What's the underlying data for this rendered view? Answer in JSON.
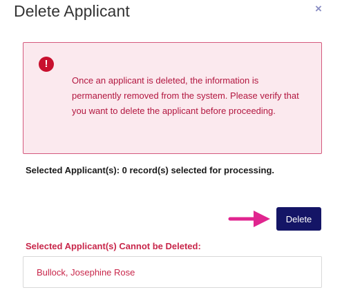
{
  "dialog": {
    "title": "Delete Applicant",
    "close_icon": "close-icon",
    "close_glyph": "×"
  },
  "alert": {
    "icon": "exclamation-circle-icon",
    "icon_glyph": "!",
    "message": "Once an applicant is deleted, the information is permanently removed from the system. Please verify that you want to delete the applicant before proceeding."
  },
  "selection": {
    "summary": "Selected Applicant(s): 0 record(s) selected for processing."
  },
  "actions": {
    "delete_label": "Delete",
    "pointer_arrow_icon": "arrow-right-icon"
  },
  "cannot_delete": {
    "title": "Selected Applicant(s) Cannot be Deleted:",
    "items": [
      "Bullock, Josephine Rose"
    ]
  },
  "colors": {
    "primary_button": "#141566",
    "alert_text": "#b2163f",
    "alert_background": "#fbe9ee",
    "alert_border": "#d4587c",
    "arrow": "#e0258f",
    "error_label": "#c8264a"
  }
}
